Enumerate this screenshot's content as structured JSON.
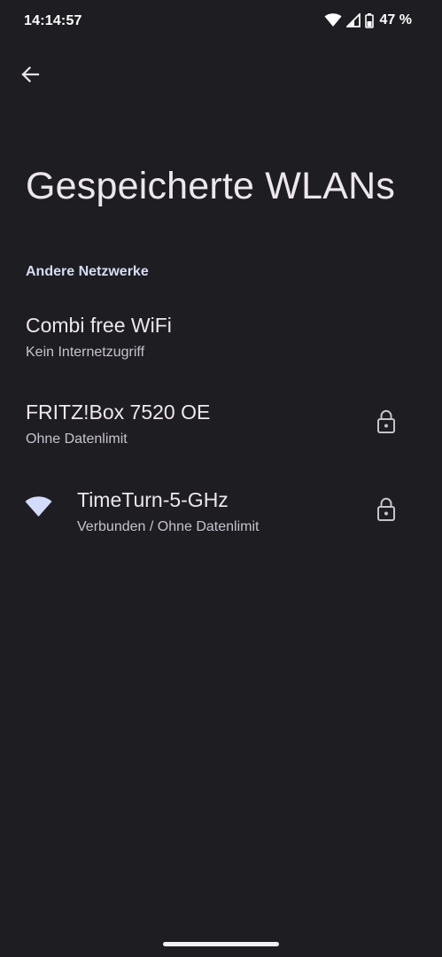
{
  "status_bar": {
    "time": "14:14:57",
    "battery_percent": "47 %"
  },
  "page": {
    "title": "Gespeicherte WLANs"
  },
  "section": {
    "header": "Andere Netzwerke"
  },
  "networks": [
    {
      "name": "Combi free WiFi",
      "status": "Kein Internetzugriff",
      "secured": false,
      "connected": false
    },
    {
      "name": "FRITZ!Box 7520 OE",
      "status": "Ohne Datenlimit",
      "secured": true,
      "connected": false
    },
    {
      "name": "TimeTurn-5-GHz",
      "status": "Verbunden / Ohne Datenlimit",
      "secured": true,
      "connected": true
    }
  ],
  "colors": {
    "background": "#1e1d22",
    "accent": "#d6dcf3",
    "wifi_connected": "#d3dcff"
  },
  "icons": {
    "back": "arrow-back-icon",
    "lock": "lock-icon",
    "wifi": "wifi-icon"
  }
}
